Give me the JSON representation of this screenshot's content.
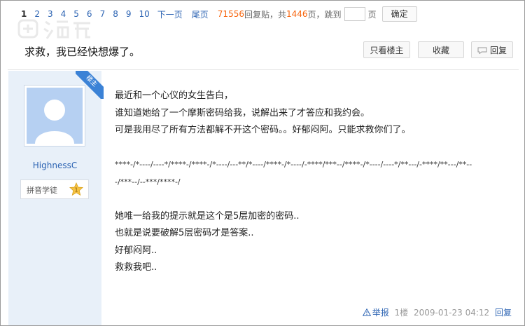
{
  "pager": {
    "current": "1",
    "pages": [
      "2",
      "3",
      "4",
      "5",
      "6",
      "7",
      "8",
      "9",
      "10"
    ],
    "next": "下一页",
    "last": "尾页",
    "reply_count": "71556",
    "reply_text": "回复贴，共",
    "page_count": "1446",
    "page_text": "页，跳到",
    "page_unit": "页",
    "confirm": "确定"
  },
  "thread": {
    "title": "求救，我已经快想爆了。",
    "only_op": "只看楼主",
    "favorite": "收藏",
    "reply": "回复"
  },
  "author": {
    "name": "HighnessC",
    "badge": "拼音学徒",
    "level": "1",
    "owner_tag": "楼主"
  },
  "post": {
    "lines": [
      "最近和一个心仪的女生告白，",
      "谁知道她给了一个摩斯密码给我，说解出来了才答应和我约会。",
      "可是我用尽了所有方法都解不开这个密码。。好郁闷阿。只能求救你们了。"
    ],
    "morse1": "****-/*----/----*/****-/****-/*----/---**/*----/****-/*----/-****/***--/****-/*----/----*/**---/-****/**---/**--",
    "morse2": "-/***--/--***/****-/",
    "lines2": [
      "她唯一给我的提示就是这个是5层加密的密码..",
      "也就是说要破解5层密码才是答案..",
      "好郁闷阿..",
      "救救我吧.."
    ]
  },
  "footer": {
    "report": "举报",
    "floor": "1楼",
    "datetime": "2009-01-23 04:12",
    "reply": "回复"
  },
  "colors": {
    "link": "#2d64b3",
    "highlight": "#f7640c",
    "sidebar_bg": "#e8f0f9",
    "ribbon": "#3b82d6"
  }
}
